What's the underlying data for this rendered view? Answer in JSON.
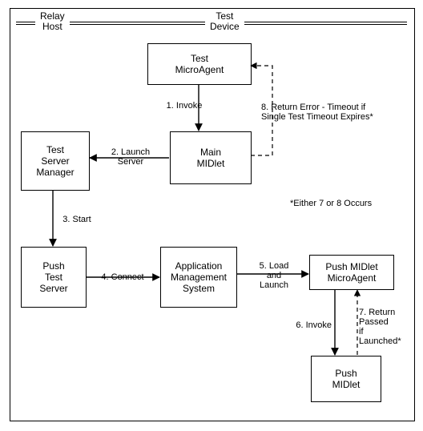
{
  "header": {
    "relay_host": "Relay\nHost",
    "test_device": "Test\nDevice"
  },
  "boxes": {
    "test_microagent": "Test\nMicroAgent",
    "main_midlet": "Main\nMIDlet",
    "test_server_manager": "Test\nServer\nManager",
    "push_test_server": "Push\nTest\nServer",
    "ams": "Application\nManagement\nSystem",
    "push_midlet_microagent": "Push MIDlet\nMicroAgent",
    "push_midlet": "Push\nMIDlet"
  },
  "edges": {
    "e1": "1. Invoke",
    "e2": "2. Launch\nServer",
    "e3": "3. Start",
    "e4": "4. Connect",
    "e5": "5. Load\nand\nLaunch",
    "e6": "6. Invoke",
    "e7": "7. Return\nPassed\nif\nLaunched*",
    "e8": "8. Return Error - Timeout if\nSingle Test Timeout Expires*"
  },
  "note": "*Either 7 or 8 Occurs",
  "chart_data": {
    "type": "diagram",
    "title": "",
    "regions": [
      {
        "name": "Relay Host",
        "nodes": [
          "Test Server Manager",
          "Push Test Server"
        ]
      },
      {
        "name": "Test Device",
        "nodes": [
          "Test MicroAgent",
          "Main MIDlet",
          "Application Management System",
          "Push MIDlet MicroAgent",
          "Push MIDlet"
        ]
      }
    ],
    "nodes": [
      "Test MicroAgent",
      "Main MIDlet",
      "Test Server Manager",
      "Push Test Server",
      "Application Management System",
      "Push MIDlet MicroAgent",
      "Push MIDlet"
    ],
    "edges": [
      {
        "n": 1,
        "from": "Test MicroAgent",
        "to": "Main MIDlet",
        "label": "Invoke",
        "style": "solid"
      },
      {
        "n": 2,
        "from": "Main MIDlet",
        "to": "Test Server Manager",
        "label": "Launch Server",
        "style": "solid"
      },
      {
        "n": 3,
        "from": "Test Server Manager",
        "to": "Push Test Server",
        "label": "Start",
        "style": "solid"
      },
      {
        "n": 4,
        "from": "Push Test Server",
        "to": "Application Management System",
        "label": "Connect",
        "style": "solid"
      },
      {
        "n": 5,
        "from": "Application Management System",
        "to": "Push MIDlet MicroAgent",
        "label": "Load and Launch",
        "style": "solid"
      },
      {
        "n": 6,
        "from": "Push MIDlet MicroAgent",
        "to": "Push MIDlet",
        "label": "Invoke",
        "style": "solid"
      },
      {
        "n": 7,
        "from": "Push MIDlet",
        "to": "Push MIDlet MicroAgent",
        "label": "Return Passed if Launched*",
        "style": "dashed"
      },
      {
        "n": 8,
        "from": "Main MIDlet",
        "to": "Test MicroAgent",
        "label": "Return Error - Timeout if Single Test Timeout Expires*",
        "style": "dashed"
      }
    ],
    "note": "*Either 7 or 8 Occurs"
  }
}
